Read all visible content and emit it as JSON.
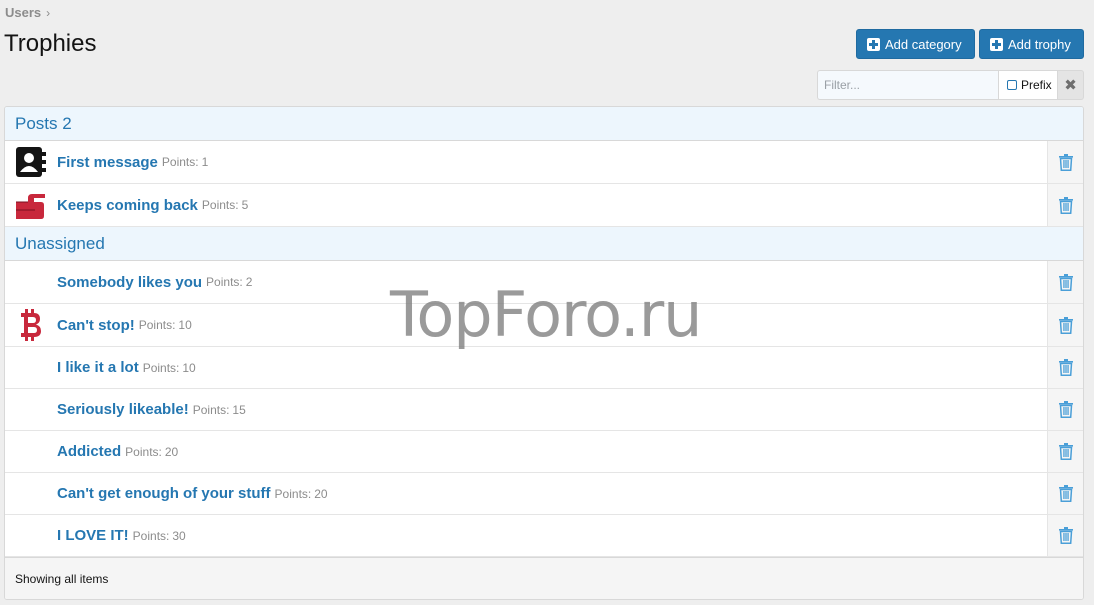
{
  "breadcrumb": {
    "items": [
      "Users"
    ],
    "separator": "›"
  },
  "page": {
    "title": "Trophies"
  },
  "actions": {
    "add_category": "Add category",
    "add_trophy": "Add trophy"
  },
  "filter": {
    "placeholder": "Filter...",
    "prefix_label": "Prefix",
    "clear_icon": "✖"
  },
  "categories": [
    {
      "name": "Posts 2",
      "trophies": [
        {
          "title": "First message",
          "points_label": "Points:",
          "points": "1",
          "icon": "contact-book-icon"
        },
        {
          "title": "Keeps coming back",
          "points_label": "Points:",
          "points": "5",
          "icon": "pointing-hand-icon"
        }
      ]
    },
    {
      "name": "Unassigned",
      "trophies": [
        {
          "title": "Somebody likes you",
          "points_label": "Points:",
          "points": "2",
          "icon": ""
        },
        {
          "title": "Can't stop!",
          "points_label": "Points:",
          "points": "10",
          "icon": "bitcoin-icon"
        },
        {
          "title": "I like it a lot",
          "points_label": "Points:",
          "points": "10",
          "icon": ""
        },
        {
          "title": "Seriously likeable!",
          "points_label": "Points:",
          "points": "15",
          "icon": ""
        },
        {
          "title": "Addicted",
          "points_label": "Points:",
          "points": "20",
          "icon": ""
        },
        {
          "title": "Can't get enough of your stuff",
          "points_label": "Points:",
          "points": "20",
          "icon": ""
        },
        {
          "title": "I LOVE IT!",
          "points_label": "Points:",
          "points": "30",
          "icon": ""
        }
      ]
    }
  ],
  "footer": {
    "status": "Showing all items"
  },
  "watermark": "TopForo.ru",
  "colors": {
    "accent": "#2577b1",
    "header_bg": "#edf6fd",
    "page_bg": "#eeeeee"
  }
}
